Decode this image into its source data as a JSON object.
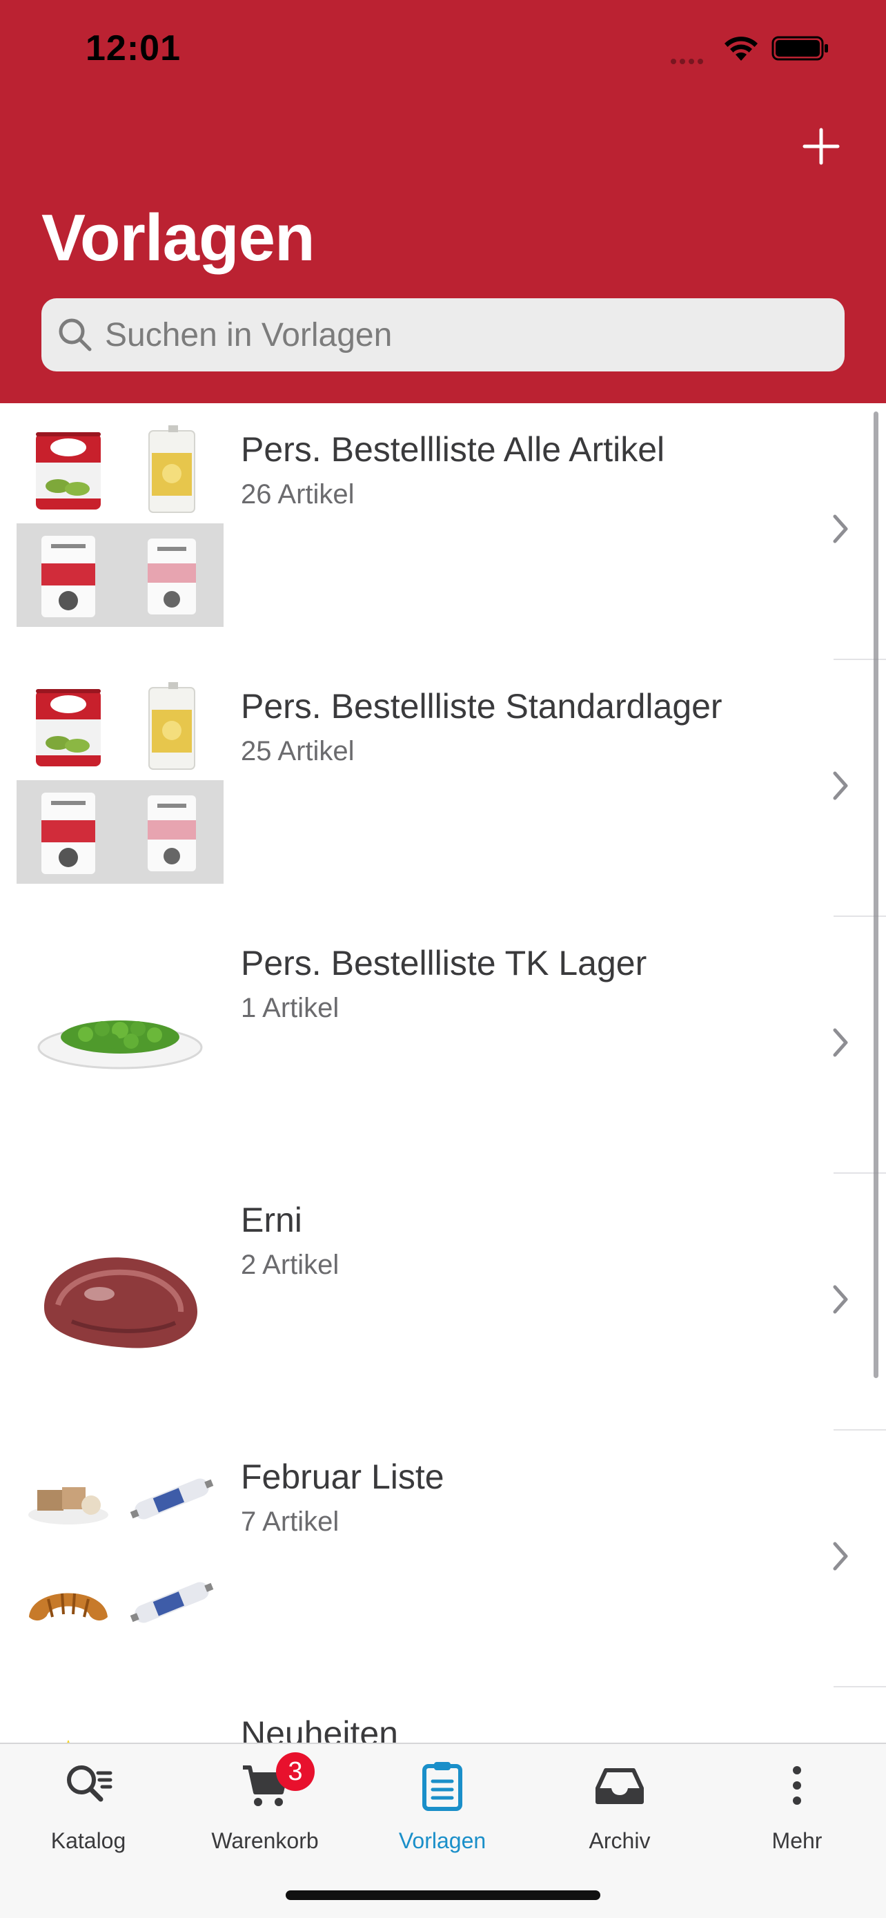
{
  "status_bar": {
    "time": "12:01"
  },
  "header": {
    "title": "Vorlagen",
    "search_placeholder": "Suchen in Vorlagen",
    "accent_color": "#bb2232"
  },
  "templates": [
    {
      "title": "Pers. Bestellliste Alle Artikel",
      "count": "26 Artikel"
    },
    {
      "title": "Pers. Bestellliste Standardlager",
      "count": "25 Artikel"
    },
    {
      "title": "Pers. Bestellliste TK Lager",
      "count": "1 Artikel"
    },
    {
      "title": "Erni",
      "count": "2 Artikel"
    },
    {
      "title": "Februar Liste",
      "count": "7 Artikel"
    },
    {
      "title": "Neuheiten",
      "count": ""
    }
  ],
  "tabbar": {
    "active_color": "#1a8fc9",
    "cart_badge": "3",
    "tabs": [
      {
        "label": "Katalog",
        "icon": "catalog-search-icon"
      },
      {
        "label": "Warenkorb",
        "icon": "cart-icon"
      },
      {
        "label": "Vorlagen",
        "icon": "clipboard-icon"
      },
      {
        "label": "Archiv",
        "icon": "inbox-archive-icon"
      },
      {
        "label": "Mehr",
        "icon": "more-vertical-icon"
      }
    ]
  }
}
